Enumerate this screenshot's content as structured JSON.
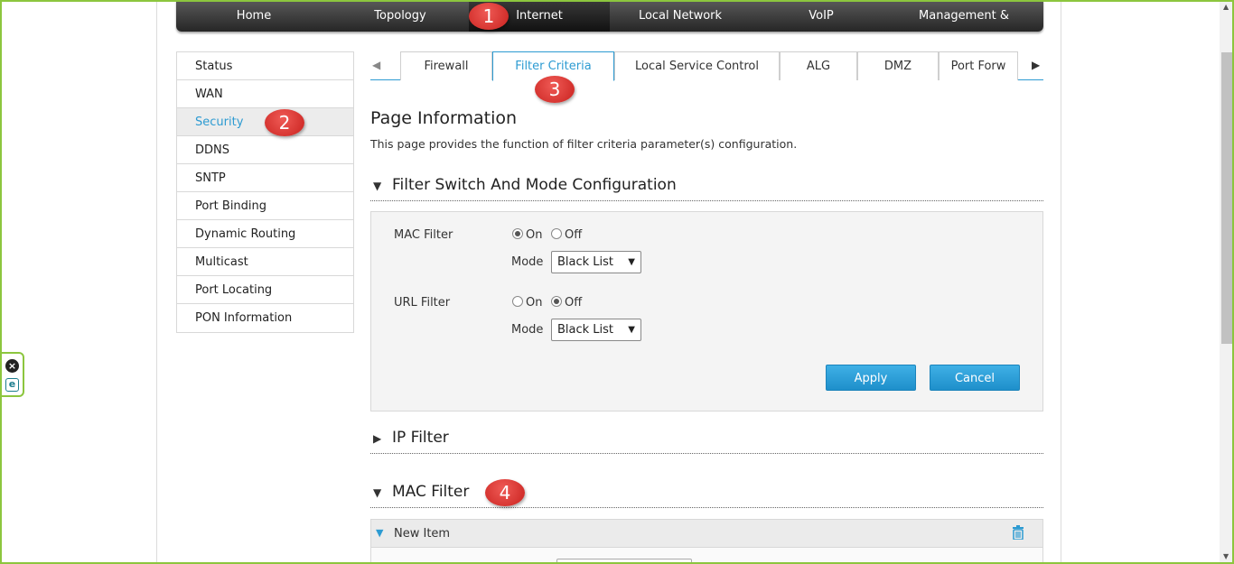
{
  "topnav": {
    "items": [
      {
        "label": "Home"
      },
      {
        "label": "Topology"
      },
      {
        "label": "Internet"
      },
      {
        "label": "Local Network"
      },
      {
        "label": "VoIP"
      },
      {
        "label": "Management & Diagnosis"
      }
    ]
  },
  "sidebar": {
    "items": [
      {
        "label": "Status"
      },
      {
        "label": "WAN"
      },
      {
        "label": "Security"
      },
      {
        "label": "DDNS"
      },
      {
        "label": "SNTP"
      },
      {
        "label": "Port Binding"
      },
      {
        "label": "Dynamic Routing"
      },
      {
        "label": "Multicast"
      },
      {
        "label": "Port Locating"
      },
      {
        "label": "PON Information"
      }
    ]
  },
  "tabs": {
    "left_arrow": "◀",
    "right_arrow": "▶",
    "items": [
      {
        "label": "Firewall"
      },
      {
        "label": "Filter Criteria"
      },
      {
        "label": "Local Service Control"
      },
      {
        "label": "ALG"
      },
      {
        "label": "DMZ"
      },
      {
        "label": "Port Forw"
      }
    ]
  },
  "page": {
    "title": "Page Information",
    "description": "This page provides the function of filter criteria parameter(s) configuration."
  },
  "sections": {
    "switch_mode": {
      "title": "Filter Switch And Mode Configuration",
      "arrow": "▼"
    },
    "ip_filter": {
      "title": "IP Filter",
      "arrow": "▶"
    },
    "mac_filter": {
      "title": "MAC Filter",
      "arrow": "▼"
    }
  },
  "config": {
    "mac_filter": {
      "label": "MAC Filter",
      "on_label": "On",
      "off_label": "Off",
      "selected": "On",
      "mode_label": "Mode",
      "mode_value": "Black List"
    },
    "url_filter": {
      "label": "URL Filter",
      "on_label": "On",
      "off_label": "Off",
      "selected": "Off",
      "mode_label": "Mode",
      "mode_value": "Black List"
    },
    "apply_label": "Apply",
    "cancel_label": "Cancel"
  },
  "new_item": {
    "label": "New Item",
    "arrow": "▼"
  },
  "callouts": {
    "c1": "1",
    "c2": "2",
    "c3": "3",
    "c4": "4"
  },
  "colors": {
    "accent": "#2d9bd2",
    "button": "#1e8fcb",
    "callout": "#d6302c",
    "frame": "#8cc63e"
  },
  "icons": {
    "close": "close-circle-icon",
    "ie": "ie-icon",
    "trash": "trash-icon",
    "select": "chevron-down-icon"
  }
}
